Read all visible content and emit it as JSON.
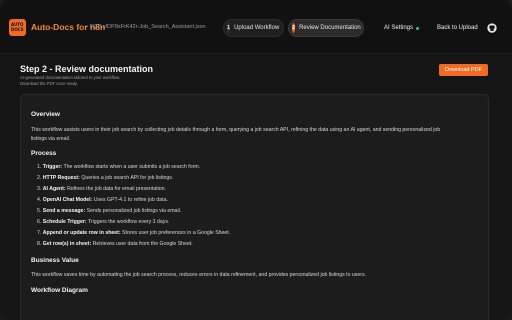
{
  "header": {
    "logo_text": "AUTO DOCS",
    "brand": "Auto-Docs for n8n",
    "filename": "• 9Q7LxfDP8xFrK42r-Job_Search_Assistant.json",
    "steps": [
      {
        "num": "1",
        "label": "Upload Workflow"
      },
      {
        "num": "2",
        "label": "Review Documentation"
      }
    ],
    "ai_settings_label": "AI Settings",
    "ai_status_color": "#2ecc71",
    "back_label": "Back to Upload",
    "github_icon": "github-icon"
  },
  "page": {
    "title": "Step 2 - Review documentation",
    "subtitle_line1": "AI-generated documentation tailored to your workflow.",
    "subtitle_line2": "Download the PDF once ready.",
    "download_label": "Download PDF"
  },
  "doc": {
    "overview_heading": "Overview",
    "overview_line1": "This workflow assists users in their job search by collecting job details through a form, querying a job search API, refining the data using an AI agent, and sending personalized job",
    "overview_line2": "listings via email.",
    "process_heading": "Process",
    "process_items": [
      {
        "num": "1.",
        "term": "Trigger:",
        "desc": " The workflow starts when a user submits a job search form."
      },
      {
        "num": "2.",
        "term": "HTTP Request:",
        "desc": " Queries a job search API for job listings."
      },
      {
        "num": "3.",
        "term": "AI Agent:",
        "desc": " Refines the job data for email presentation."
      },
      {
        "num": "4.",
        "term": "OpenAI Chat Model:",
        "desc": " Uses GPT-4.1 to refine job data."
      },
      {
        "num": "5.",
        "term": "Send a message:",
        "desc": " Sends personalized job listings via email."
      },
      {
        "num": "6.",
        "term": "Schedule Trigger:",
        "desc": " Triggers the workflow every 3 days."
      },
      {
        "num": "7.",
        "term": "Append or update row in sheet:",
        "desc": " Stores user job preferences in a Google Sheet."
      },
      {
        "num": "8.",
        "term": "Get row(s) in sheet:",
        "desc": " Retrieves user data from the Google Sheet."
      }
    ],
    "business_heading": "Business Value",
    "business_text": "This workflow saves time by automating the job search process, reduces errors in data refinement, and provides personalized job listings to users.",
    "diagram_heading": "Workflow Diagram"
  },
  "colors": {
    "accent": "#f26b22",
    "background": "#151515"
  }
}
